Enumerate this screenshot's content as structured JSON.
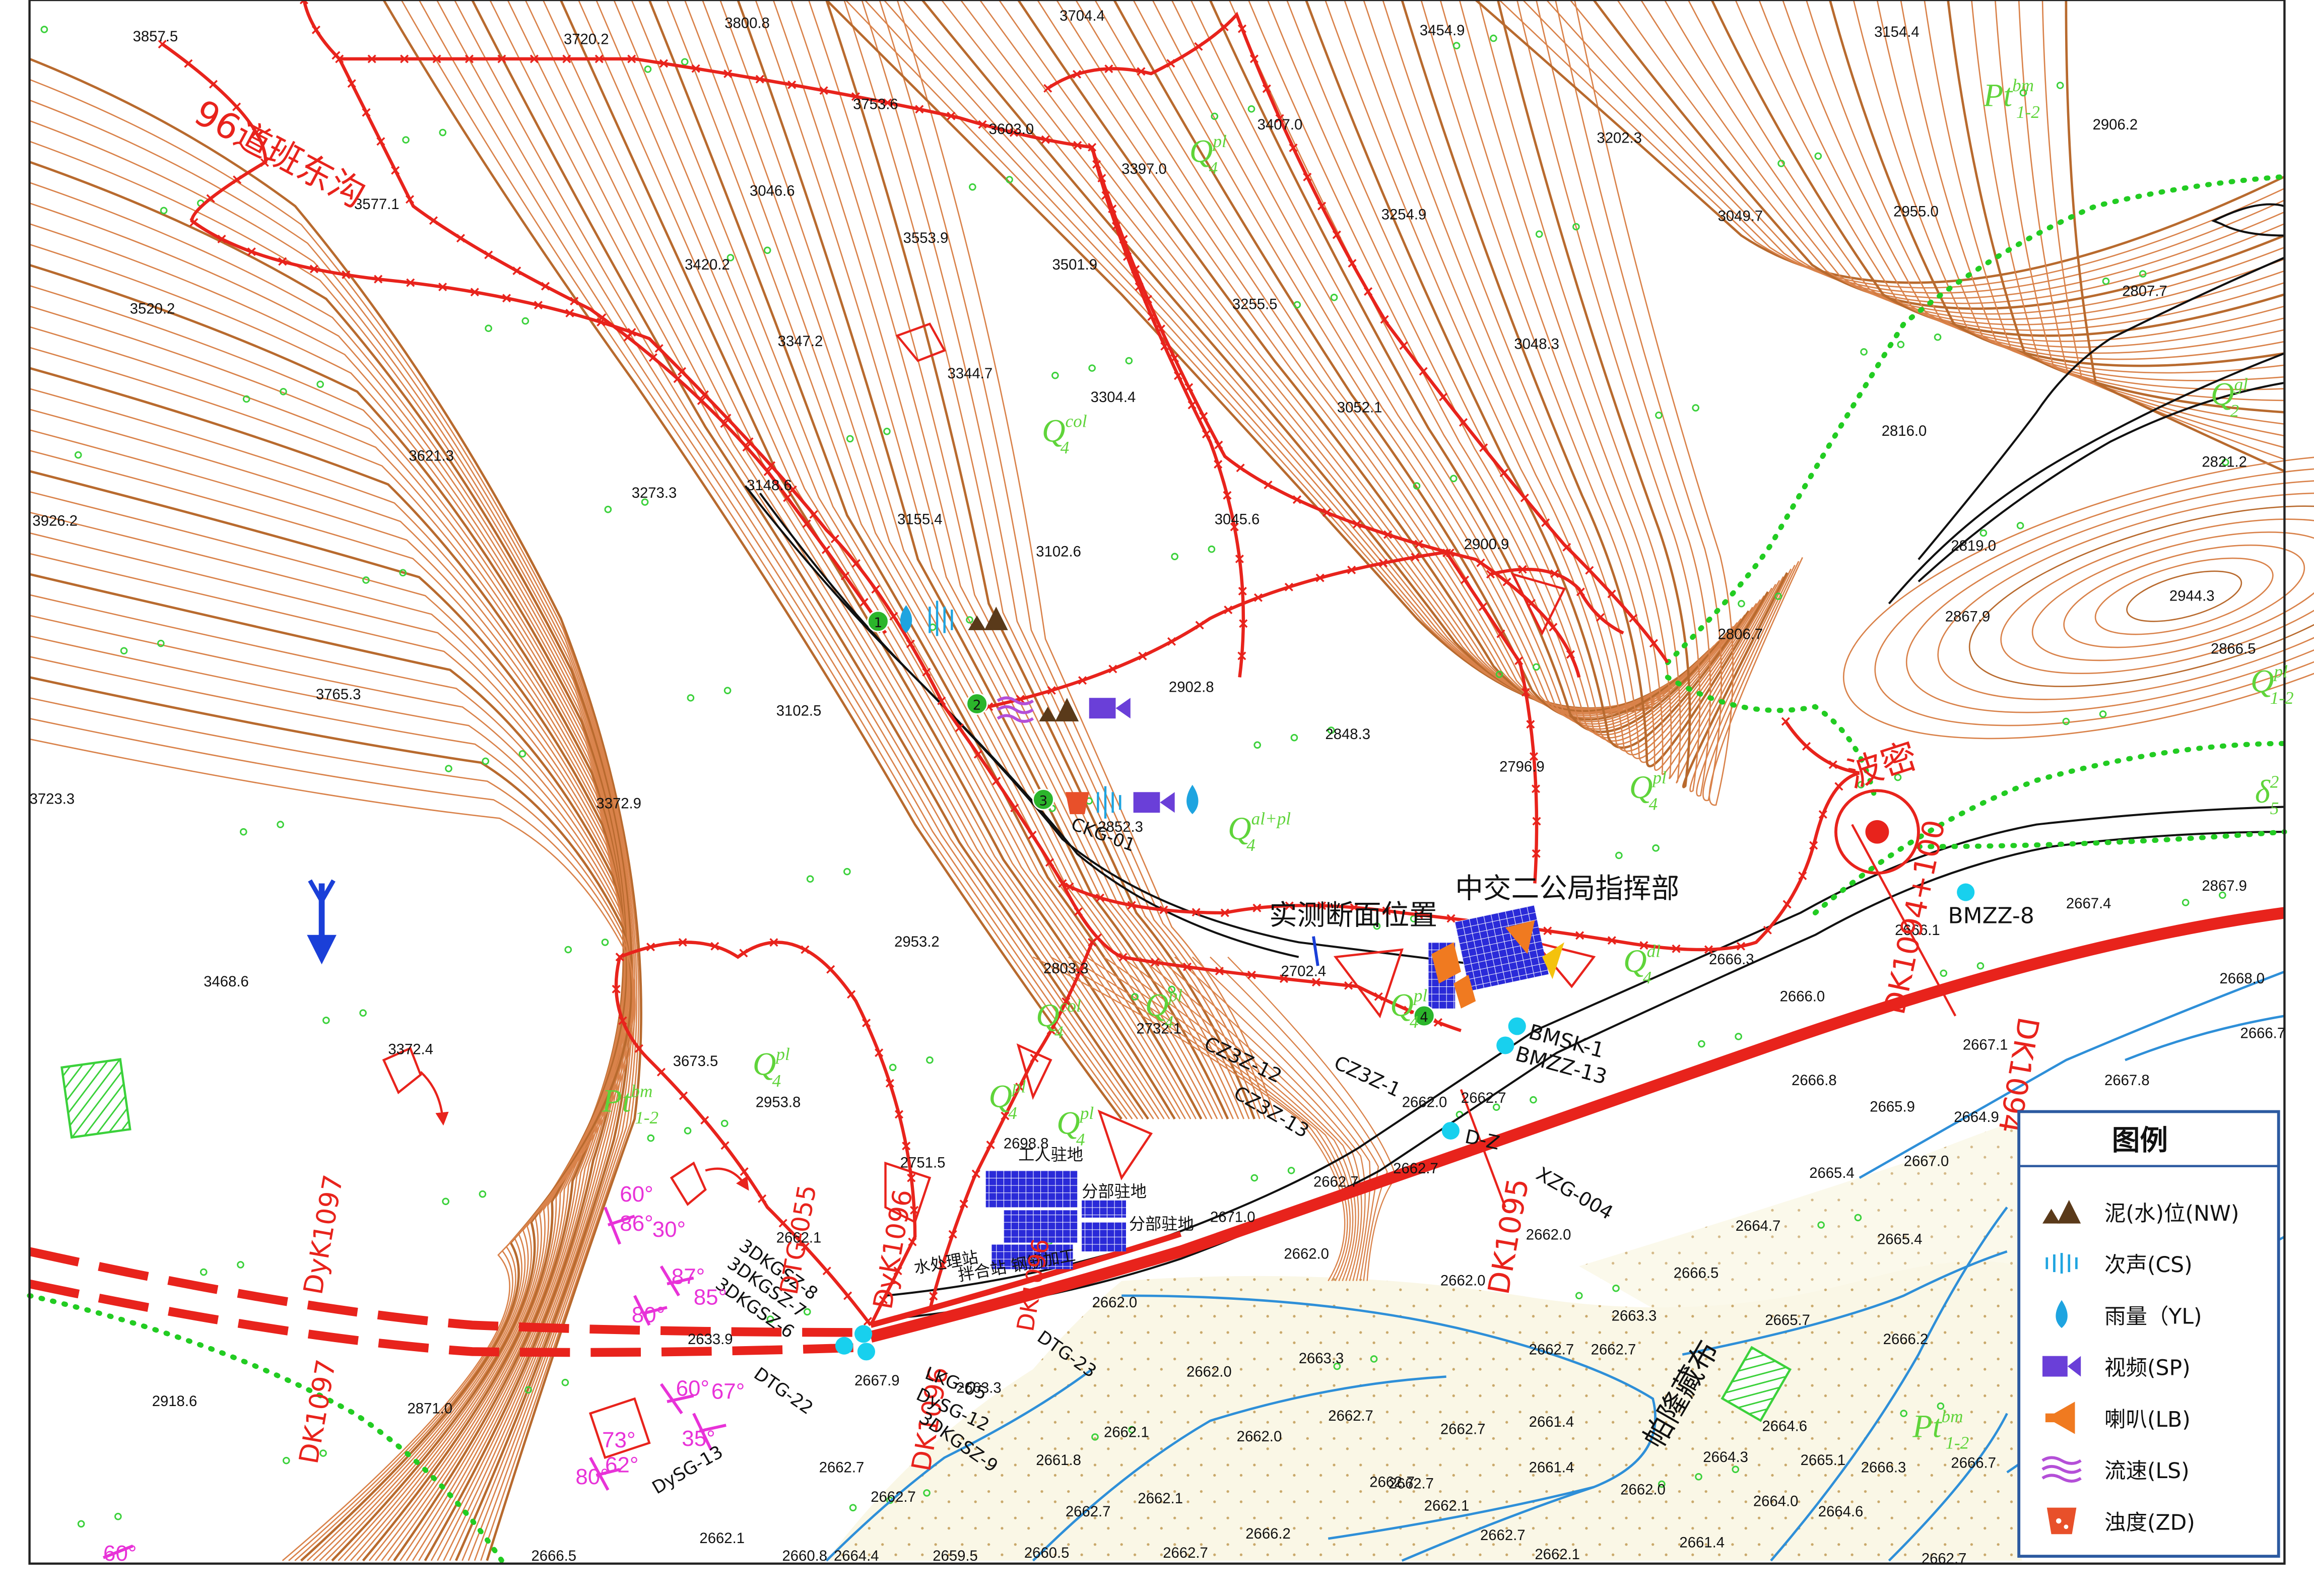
{
  "title": "",
  "place_labels": {
    "bomi": "波密",
    "command_post": "中交二公局指挥部",
    "section_position": "实测断面位置",
    "gully": "96道班东沟",
    "river": "帕隆藏布",
    "worker_camp": "工人驻地",
    "branch_camp_1": "分部驻地",
    "branch_camp_2": "分部驻地",
    "water_station": "水处理站",
    "steel_yard": "拌合站 钢筋加工"
  },
  "mileage_labels": {
    "dk1094_plus_100": "DK1094+100",
    "dk1094": "DK1094",
    "dk1095": "DK1095",
    "dk1096": "DK1096",
    "dyk1096": "DyK1096",
    "dk1097": "DK1097",
    "dyk1097": "DyK1097",
    "dk1096b": "DK1096"
  },
  "boreholes": {
    "bmzz8": "BMZZ-8",
    "bmsk": "BMSK-1",
    "bmzz13": "BMZZ-13",
    "dz": "D-Z",
    "xzg004": "XZG-004",
    "czz12a": "CZ3Z-12",
    "czz13": "CZ3Z-13",
    "czz1": "CZ3Z-1",
    "ckg01": "CKG-01",
    "lkg05": "LKG-05",
    "dysg12": "DySG-12",
    "dtg23": "DTG-23",
    "dtg22": "DTG-22",
    "dysg13": "DySG-13",
    "dkgsz9": "3DKGSZ-9",
    "dkgsz8": "3DKGSZ-8",
    "dkgsz7": "3DKGSZ-7",
    "dkgsz6": "3DKGSZ-6",
    "dtg055": "DTG-055"
  },
  "geology": [
    {
      "sym": "Q",
      "sup": "col",
      "sub": "4"
    },
    {
      "sym": "Q",
      "sup": "al+pl",
      "sub": "4"
    },
    {
      "sym": "Q",
      "sup": "pl",
      "sub": "4"
    },
    {
      "sym": "Q",
      "sup": "pl",
      "sub": "4"
    },
    {
      "sym": "Q",
      "sup": "gl",
      "sub": "2"
    },
    {
      "sym": "Pt",
      "sup": "bm",
      "sub": "1-2"
    },
    {
      "sym": "Pt",
      "sup": "bm",
      "sub": "1-2"
    },
    {
      "sym": "Q",
      "sup": "dl",
      "sub": "4"
    },
    {
      "sym": "Q",
      "sup": "col",
      "sub": "4"
    },
    {
      "sym": "Q",
      "sup": "pl",
      "sub": "4"
    },
    {
      "sym": "Q",
      "sup": "pl",
      "sub": "4"
    },
    {
      "sym": "Q",
      "sup": "pl",
      "sub": "4"
    },
    {
      "sym": "Pt",
      "sup": "bm",
      "sub": "1-2"
    },
    {
      "sym": "δ",
      "sup": "2",
      "sub": "5"
    },
    {
      "sym": "Q",
      "sup": "pl",
      "sub": "4"
    },
    {
      "sym": "Q",
      "sup": "pl",
      "sub": "4"
    },
    {
      "sym": "Q",
      "sup": "pl",
      "sub": "1-2"
    }
  ],
  "elevations": [
    "3857.5",
    "3720.2",
    "3800.8",
    "3704.4",
    "3454.9",
    "3154.4",
    "2906.2",
    "3753.6",
    "3603.0",
    "3407.0",
    "3202.3",
    "3397.0",
    "3046.6",
    "3577.1",
    "3553.9",
    "3254.9",
    "3049.7",
    "2955.0",
    "3420.2",
    "3501.9",
    "2807.7",
    "3520.2",
    "3347.2",
    "3344.7",
    "3255.5",
    "3048.3",
    "3304.4",
    "3052.1",
    "2816.0",
    "2821.2",
    "3621.3",
    "3273.3",
    "3148.6",
    "3155.4",
    "3045.6",
    "2819.0",
    "3926.2",
    "3102.6",
    "2900.9",
    "2944.3",
    "2867.9",
    "2806.7",
    "2866.5",
    "3765.3",
    "3102.5",
    "2902.8",
    "2848.3",
    "2796.9",
    "3723.3",
    "3372.9",
    "2852.3",
    "2667.4",
    "2867.9",
    "2666.1",
    "2953.2",
    "2803.3",
    "2702.4",
    "2666.3",
    "2668.0",
    "3468.6",
    "2732.1",
    "2666.0",
    "2667.1",
    "2666.7",
    "3372.4",
    "3673.5",
    "2953.8",
    "2662.0",
    "2662.7",
    "2666.8",
    "2665.9",
    "2664.9",
    "2667.8",
    "2698.8",
    "2662.7",
    "2665.4",
    "2667.0",
    "2751.5",
    "2671.0",
    "2662.7",
    "2664.7",
    "2662.0",
    "2665.4",
    "2662.0",
    "2666.5",
    "2662.0",
    "2663.3",
    "2665.7",
    "2633.9",
    "2662.0",
    "2662.7",
    "2662.7",
    "2666.2",
    "2918.6",
    "2871.0",
    "2663.3",
    "2662.0",
    "2663.3",
    "2662.7",
    "2662.7",
    "2661.4",
    "2664.6",
    "2662.1",
    "2662.0",
    "2662.7",
    "2664.3",
    "2665.1",
    "2666.3",
    "2666.7",
    "2661.8",
    "2662.1",
    "2662.7",
    "2661.4",
    "2662.7",
    "2662.7",
    "2662.7",
    "2662.1",
    "2662.0",
    "2664.0",
    "2664.6",
    "2666.2",
    "2666.5",
    "2662.1",
    "2659.5",
    "2660.5",
    "2662.7",
    "2662.7",
    "2662.1",
    "2661.4",
    "2660.8",
    "2664.4",
    "2662.7",
    "2662.1",
    "2667.9"
  ],
  "dips": [
    "60°",
    "86°",
    "30°",
    "87°",
    "85°",
    "80°",
    "60°",
    "67°",
    "35°",
    "73°",
    "62°",
    "80°",
    "60°"
  ],
  "station_numbers": [
    "1",
    "2",
    "3",
    "4"
  ],
  "legend": {
    "title": "图例",
    "items": [
      {
        "label": "泥(水)位(NW)",
        "icon": "mud-level-icon",
        "color": "#5a3a1a"
      },
      {
        "label": "次声(CS)",
        "icon": "infrasound-icon",
        "color": "#1ea4e0"
      },
      {
        "label": "雨量（YL)",
        "icon": "rain-gauge-icon",
        "color": "#1ea4e0"
      },
      {
        "label": "视频(SP)",
        "icon": "video-camera-icon",
        "color": "#6a3fd8"
      },
      {
        "label": "喇叭(LB)",
        "icon": "loudspeaker-icon",
        "color": "#f07a20"
      },
      {
        "label": "流速(LS)",
        "icon": "flow-velocity-icon",
        "color": "#b44fd8"
      },
      {
        "label": "浊度(ZD)",
        "icon": "turbidity-icon",
        "color": "#e8502a"
      }
    ]
  },
  "colors": {
    "contour": "#d9824a",
    "contour_index": "#b86a2e",
    "boundary": "#e8231c",
    "railway": "#e8231c",
    "river": "#2e8fd8",
    "geology": "#5fd43a",
    "green_dotted": "#22cc22",
    "buildings": "#2a2ad8"
  }
}
